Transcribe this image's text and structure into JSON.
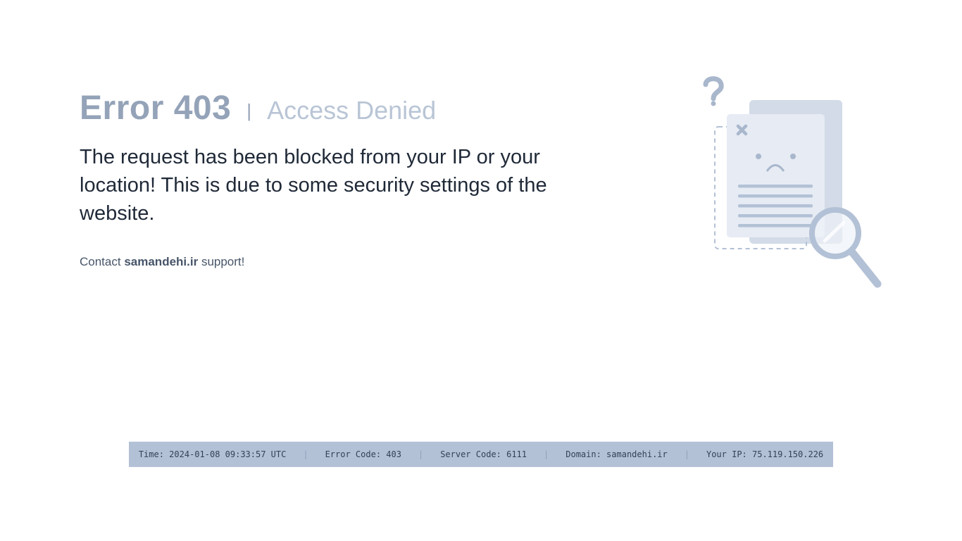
{
  "heading": {
    "error_code": "Error 403",
    "separator": "|",
    "subtitle": "Access Denied"
  },
  "message": "The request has been blocked from your IP or your location! This is due to some security settings of the website.",
  "contact": {
    "prefix": "Contact",
    "domain": "samandehi.ir",
    "suffix": "support!"
  },
  "illustration": {
    "icon": "document-search-sad-icon"
  },
  "footer": {
    "separator": "|",
    "time": "Time: 2024-01-08 09:33:57 UTC",
    "error_code": "Error Code: 403",
    "server_code": "Server Code: 6111",
    "domain": "Domain: samandehi.ir",
    "ip": "Your IP: 75.119.150.226"
  },
  "colors": {
    "heading": "#94a3b8",
    "subtitle": "#b9c5d6",
    "text": "#1f2937",
    "footer_bg": "#b3c1d6"
  }
}
